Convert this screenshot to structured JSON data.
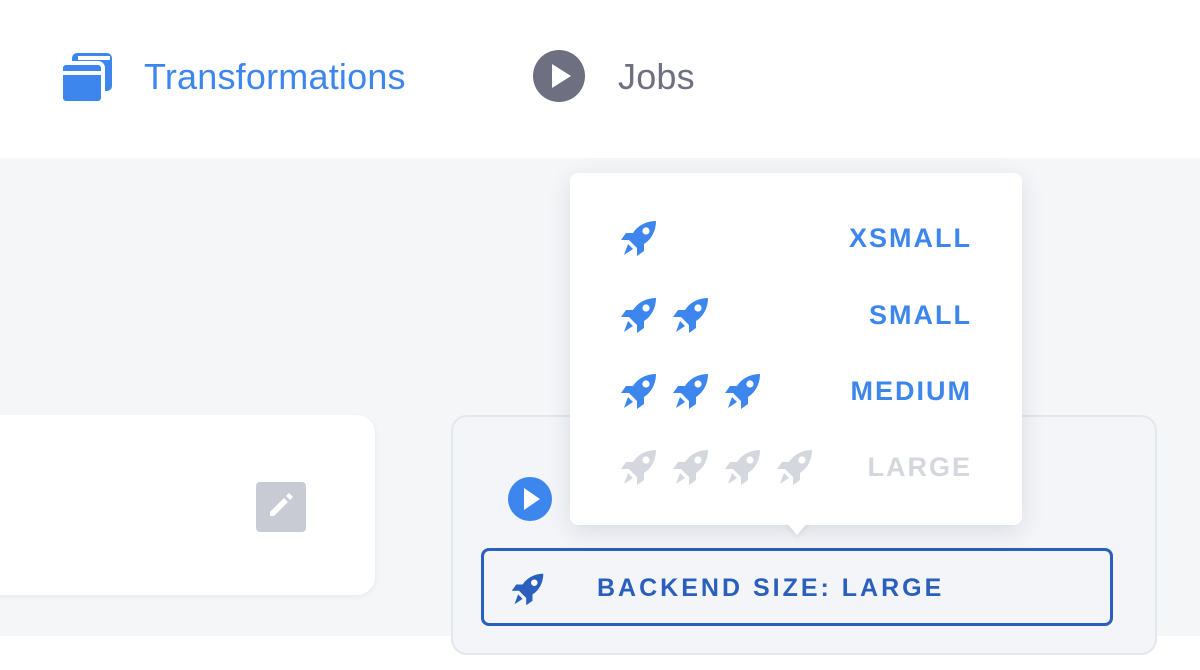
{
  "nav": {
    "transformations": {
      "label": "Transformations",
      "icon": "files-icon",
      "color": "#3d86ee"
    },
    "jobs": {
      "label": "Jobs",
      "icon": "play-circle-icon",
      "color": "#6e7082"
    }
  },
  "backend": {
    "label": "BACKEND SIZE: LARGE",
    "icon": "rocket-icon",
    "color": "#2a5fbd"
  },
  "dropdown": {
    "options": [
      {
        "label": "XSMALL",
        "rockets": 1,
        "enabled": true
      },
      {
        "label": "SMALL",
        "rockets": 2,
        "enabled": true
      },
      {
        "label": "MEDIUM",
        "rockets": 3,
        "enabled": true
      },
      {
        "label": "LARGE",
        "rockets": 4,
        "enabled": false
      }
    ],
    "accent": "#3d86ee",
    "disabled_color": "#d5d7de"
  }
}
